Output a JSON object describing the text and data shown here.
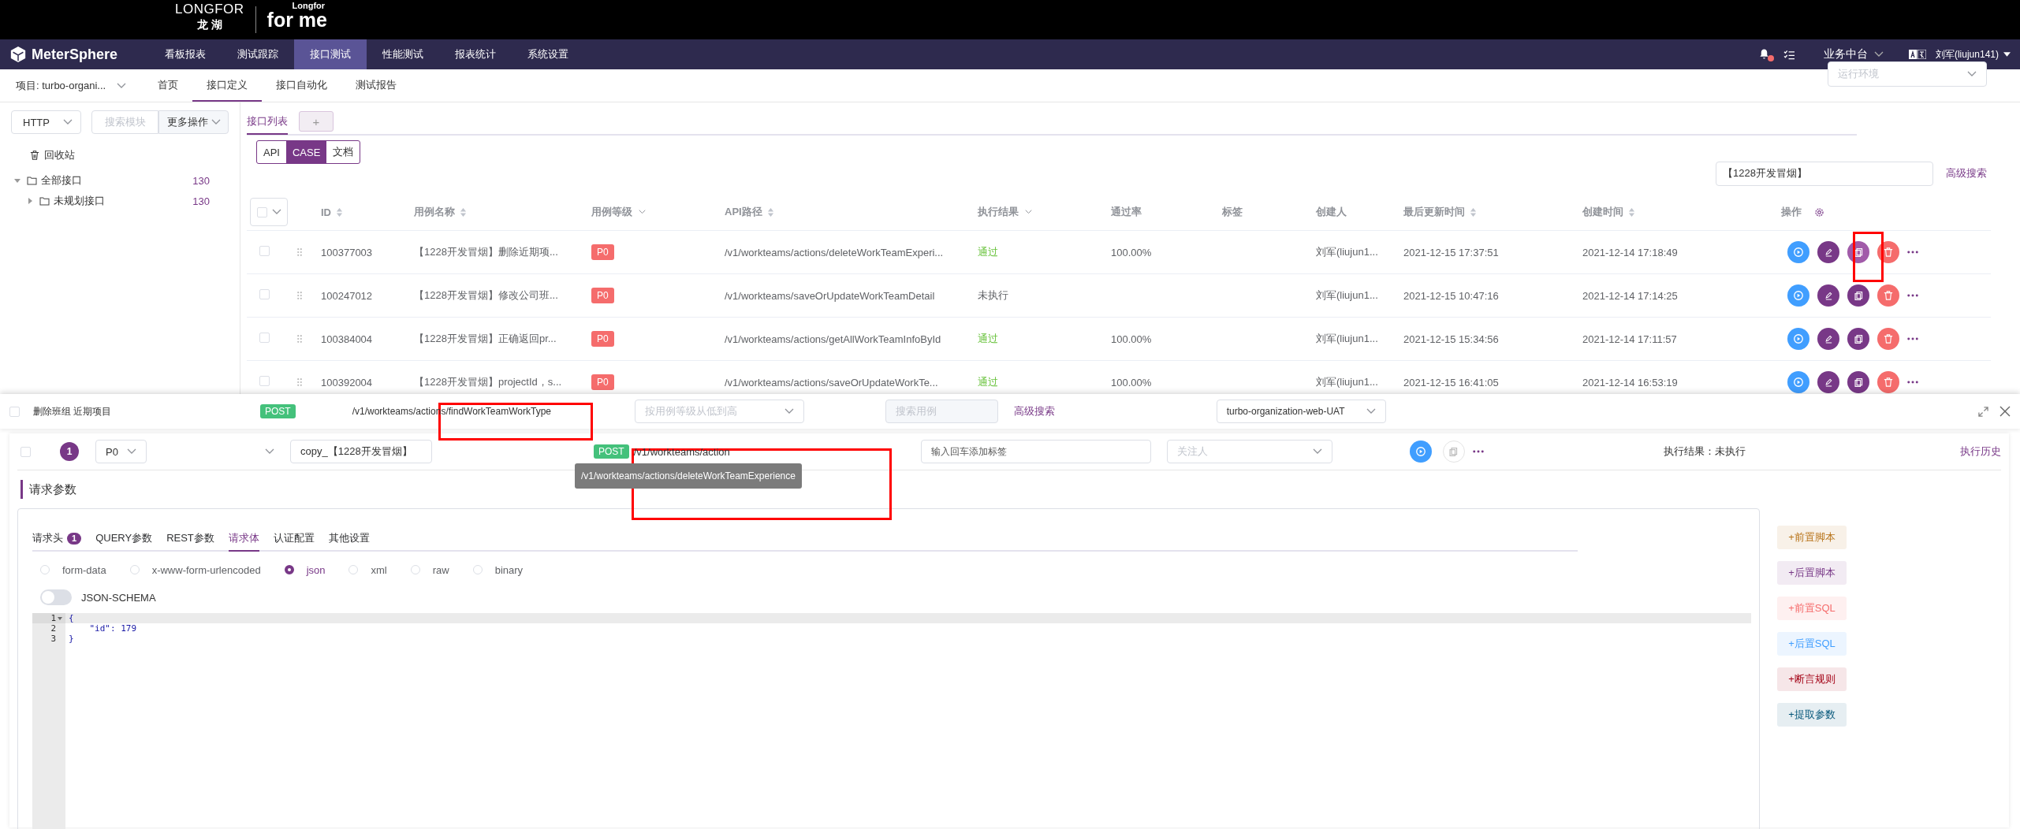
{
  "brand_bar": {
    "logo_en": "LONGFOR",
    "logo_cn": "龙 湖",
    "logo_small": "Longfor",
    "logo_big": "for me"
  },
  "nav": {
    "app_name": "MeterSphere",
    "items": [
      {
        "label": "看板报表",
        "selected": false
      },
      {
        "label": "测试跟踪",
        "selected": false
      },
      {
        "label": "接口测试",
        "selected": true
      },
      {
        "label": "性能测试",
        "selected": false
      },
      {
        "label": "报表统计",
        "selected": false
      },
      {
        "label": "系统设置",
        "selected": false
      }
    ],
    "unread_notifications": true,
    "workspace": "业务中台",
    "user": "刘军(liujun141)"
  },
  "sub_nav": {
    "project": "项目: turbo-organi...",
    "items": [
      {
        "label": "首页",
        "selected": false
      },
      {
        "label": "接口定义",
        "selected": true
      },
      {
        "label": "接口自动化",
        "selected": false
      },
      {
        "label": "测试报告",
        "selected": false
      }
    ],
    "environment_placeholder": "运行环境"
  },
  "sidebar": {
    "protocol": "HTTP",
    "search_placeholder": "搜索模块",
    "more_button": "更多操作",
    "trash": "回收站",
    "tree": [
      {
        "label": "全部接口",
        "count": "130",
        "expanded": true,
        "children": [
          {
            "label": "未规划接口",
            "count": "130",
            "expanded": false
          }
        ]
      }
    ]
  },
  "tabs": [
    {
      "label": "接口列表",
      "selected": true
    }
  ],
  "add_tab": "+",
  "view_switch": [
    {
      "label": "API",
      "selected": false
    },
    {
      "label": "CASE",
      "selected": true
    },
    {
      "label": "文档",
      "selected": false
    }
  ],
  "search": {
    "value": "【1228开发冒烟】",
    "advanced": "高级搜索"
  },
  "table": {
    "all_checked": false,
    "columns": [
      {
        "label": "ID",
        "kind": "sort"
      },
      {
        "label": "用例名称",
        "kind": "sort"
      },
      {
        "label": "用例等级",
        "kind": "filter"
      },
      {
        "label": "API路径",
        "kind": "sort"
      },
      {
        "label": "执行结果",
        "kind": "filter"
      },
      {
        "label": "通过率",
        "kind": "plain"
      },
      {
        "label": "标签",
        "kind": "plain"
      },
      {
        "label": "创建人",
        "kind": "plain"
      },
      {
        "label": "最后更新时间",
        "kind": "sort"
      },
      {
        "label": "创建时间",
        "kind": "sort"
      },
      {
        "label": "操作",
        "kind": "settings"
      }
    ],
    "rows": [
      {
        "id": "100377003",
        "name": "【1228开发冒烟】删除近期项...",
        "priority": "P0",
        "path": "/v1/workteams/actions/deleteWorkTeamExperi...",
        "result": {
          "text": "通过",
          "color": "#67c23a"
        },
        "checked": false,
        "pass_rate": "100.00%",
        "creator": "刘军(liujun1...",
        "updated": "2021-12-15 17:37:51",
        "created": "2021-12-14 17:18:49",
        "copy_hovered": true
      },
      {
        "id": "100247012",
        "name": "【1228开发冒烟】修改公司班...",
        "priority": "P0",
        "path": "/v1/workteams/saveOrUpdateWorkTeamDetail",
        "result": {
          "text": "未执行",
          "color": "#606266"
        },
        "checked": false,
        "creator": "刘军(liujun1...",
        "updated": "2021-12-15 10:47:16",
        "created": "2021-12-14 17:14:25",
        "copy_hovered": false
      },
      {
        "id": "100384004",
        "name": "【1228开发冒烟】正确返回pr...",
        "priority": "P0",
        "path": "/v1/workteams/actions/getAllWorkTeamInfoById",
        "result": {
          "text": "通过",
          "color": "#67c23a"
        },
        "checked": false,
        "pass_rate": "100.00%",
        "creator": "刘军(liujun1...",
        "updated": "2021-12-15 15:34:56",
        "created": "2021-12-14 17:11:57",
        "copy_hovered": false
      },
      {
        "id": "100392004",
        "name": "【1228开发冒烟】projectId，s...",
        "priority": "P0",
        "path": "/v1/workteams/actions/saveOrUpdateWorkTe...",
        "result": {
          "text": "通过",
          "color": "#67c23a"
        },
        "checked": false,
        "pass_rate": "100.00%",
        "creator": "刘军(liujun1...",
        "updated": "2021-12-15 16:41:05",
        "created": "2021-12-14 16:53:19",
        "copy_hovered": false
      }
    ]
  },
  "case_panel": {
    "header": {
      "checked": false,
      "name": "删除班组 近期项目",
      "method": "POST",
      "path": "/v1/workteams/actions/findWorkTeamWorkType",
      "sort_placeholder": "按用例等级从低到高",
      "search_placeholder": "搜索用例",
      "advanced": "高级搜索",
      "environment": "turbo-organization-web-UAT"
    },
    "case": {
      "checked": false,
      "index": "1",
      "priority": "P0",
      "name": "copy_【1228开发冒烟】",
      "method": "POST",
      "path": "/v1/workteams/action",
      "tag_placeholder": "输入回车添加标签",
      "follower_placeholder": "关注人",
      "result": "执行结果：未执行",
      "history": "执行历史"
    },
    "tooltip": "/v1/workteams/actions/deleteWorkTeamExperience",
    "section_title": "请求参数",
    "request_tabs": [
      {
        "label": "请求头",
        "badge": "1",
        "selected": false
      },
      {
        "label": "QUERY参数",
        "selected": false
      },
      {
        "label": "REST参数",
        "selected": false
      },
      {
        "label": "请求体",
        "selected": true
      },
      {
        "label": "认证配置",
        "selected": false
      },
      {
        "label": "其他设置",
        "selected": false
      }
    ],
    "body_types": [
      {
        "label": "form-data",
        "selected": false
      },
      {
        "label": "x-www-form-urlencoded",
        "selected": false
      },
      {
        "label": "json",
        "selected": true
      },
      {
        "label": "xml",
        "selected": false
      },
      {
        "label": "raw",
        "selected": false
      },
      {
        "label": "binary",
        "selected": false
      }
    ],
    "json_schema": {
      "label": "JSON-SCHEMA",
      "on": false
    },
    "code_lines": [
      {
        "number": "1",
        "text": "{",
        "foldable": true
      },
      {
        "number": "2",
        "text": "    \"id\": 179",
        "foldable": false
      },
      {
        "number": "3",
        "text": "}",
        "foldable": false
      }
    ],
    "side_actions": [
      {
        "label": "+前置脚本",
        "color": "#b8741a"
      },
      {
        "label": "+后置脚本",
        "color": "#783887"
      },
      {
        "label": "+前置SQL",
        "color": "#f56c6c"
      },
      {
        "label": "+后置SQL",
        "color": "#409eff"
      },
      {
        "label": "+断言规则",
        "color": "#a30014"
      },
      {
        "label": "+提取参数",
        "color": "#015478"
      }
    ]
  }
}
